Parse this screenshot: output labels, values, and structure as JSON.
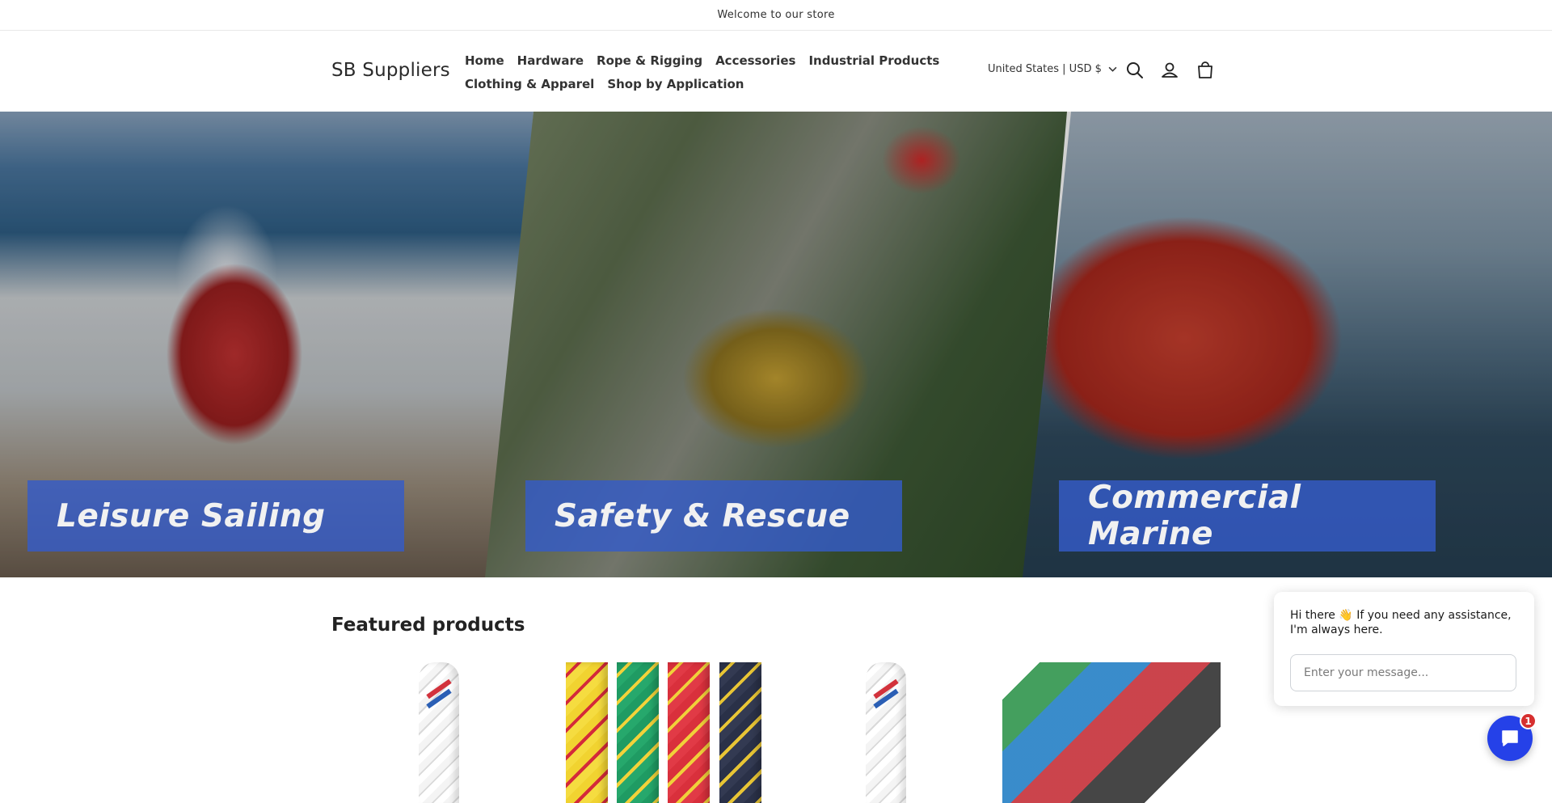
{
  "announcement": "Welcome to our store",
  "header": {
    "logo": "SB Suppliers",
    "nav_row1": [
      "Home",
      "Hardware",
      "Rope & Rigging",
      "Accessories",
      "Industrial Products"
    ],
    "nav_row2": [
      "Clothing & Apparel",
      "Shop by Application"
    ],
    "country_selector": "United States | USD $",
    "icons": [
      "search-icon",
      "account-icon",
      "cart-icon"
    ]
  },
  "hero": {
    "labels": [
      "Leisure Sailing",
      "Safety & Rescue",
      "Commercial Marine"
    ]
  },
  "featured": {
    "title": "Featured products"
  },
  "chat": {
    "greeting": "Hi there 👋 If you need any assistance, I'm always here.",
    "placeholder": "Enter your message...",
    "badge_count": "1"
  },
  "colors": {
    "hero_label_bg": "#345cc8",
    "chat_button": "#2541e8",
    "badge": "#d62f2f"
  }
}
